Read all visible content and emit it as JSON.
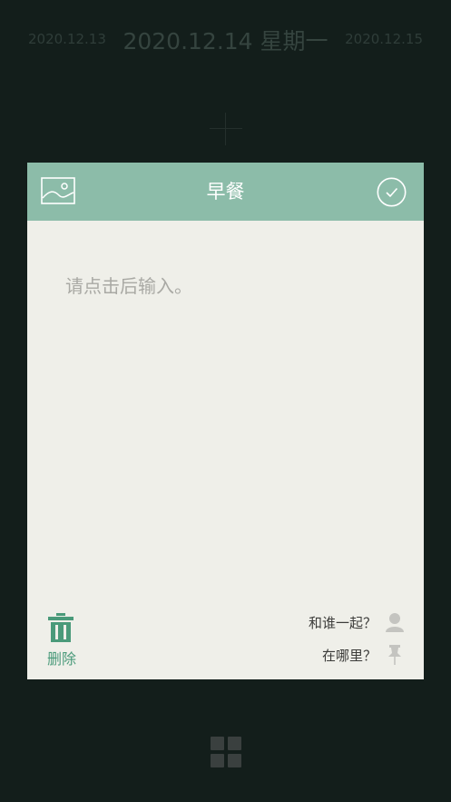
{
  "date_bar": {
    "prev_date": "2020.12.13",
    "current_date": "2020.12.14 星期一",
    "next_date": "2020.12.15"
  },
  "card": {
    "title": "早餐",
    "image_icon": "image-icon",
    "confirm_icon": "check-circle-icon",
    "placeholder": "请点击后输入。",
    "delete_label": "删除",
    "companion_label": "和谁一起？",
    "location_label": "在哪里？"
  },
  "colors": {
    "background": "#131e1b",
    "header": "#8cbca9",
    "card": "#efefe9",
    "accent": "#4a9a7a"
  }
}
